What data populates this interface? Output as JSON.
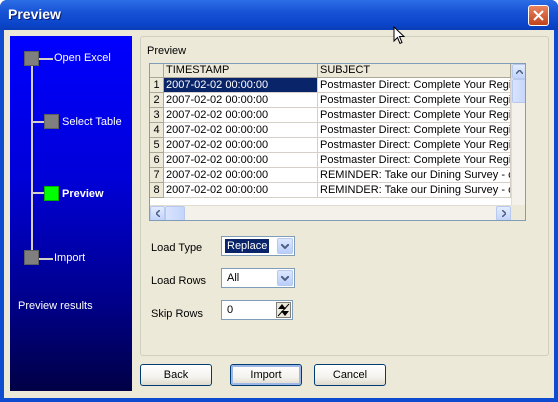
{
  "window": {
    "title": "Preview"
  },
  "steps": [
    {
      "label": "Open Excel"
    },
    {
      "label": "Select Table"
    },
    {
      "label": "Preview"
    },
    {
      "label": "Import"
    }
  ],
  "left_status": "Preview results",
  "group": {
    "label": "Preview"
  },
  "grid": {
    "columns": [
      "TIMESTAMP",
      "SUBJECT"
    ],
    "rows": [
      {
        "num": "1",
        "timestamp": "2007-02-02 00:00:00",
        "subject": "Postmaster Direct: Complete Your Registration"
      },
      {
        "num": "2",
        "timestamp": "2007-02-02 00:00:00",
        "subject": "Postmaster Direct: Complete Your Registration"
      },
      {
        "num": "3",
        "timestamp": "2007-02-02 00:00:00",
        "subject": "Postmaster Direct: Complete Your Registration"
      },
      {
        "num": "4",
        "timestamp": "2007-02-02 00:00:00",
        "subject": "Postmaster Direct: Complete Your Registration"
      },
      {
        "num": "5",
        "timestamp": "2007-02-02 00:00:00",
        "subject": "Postmaster Direct: Complete Your Registration"
      },
      {
        "num": "6",
        "timestamp": "2007-02-02 00:00:00",
        "subject": "Postmaster Direct: Complete Your Registration"
      },
      {
        "num": "7",
        "timestamp": "2007-02-02 00:00:00",
        "subject": "REMINDER: Take our Dining Survey - chance"
      },
      {
        "num": "8",
        "timestamp": "2007-02-02 00:00:00",
        "subject": "REMINDER: Take our Dining Survey - chance"
      }
    ]
  },
  "fields": {
    "load_type": {
      "label": "Load Type",
      "value": "Replace"
    },
    "load_rows": {
      "label": "Load Rows",
      "value": "All"
    },
    "skip_rows": {
      "label": "Skip Rows",
      "value": "0"
    }
  },
  "buttons": {
    "back": "Back",
    "import": "Import",
    "cancel": "Cancel"
  },
  "colors": {
    "title_bar": "#0b45c9",
    "selection": "#0a246a",
    "active_step": "#00ff00",
    "panel": "#0000ff"
  }
}
